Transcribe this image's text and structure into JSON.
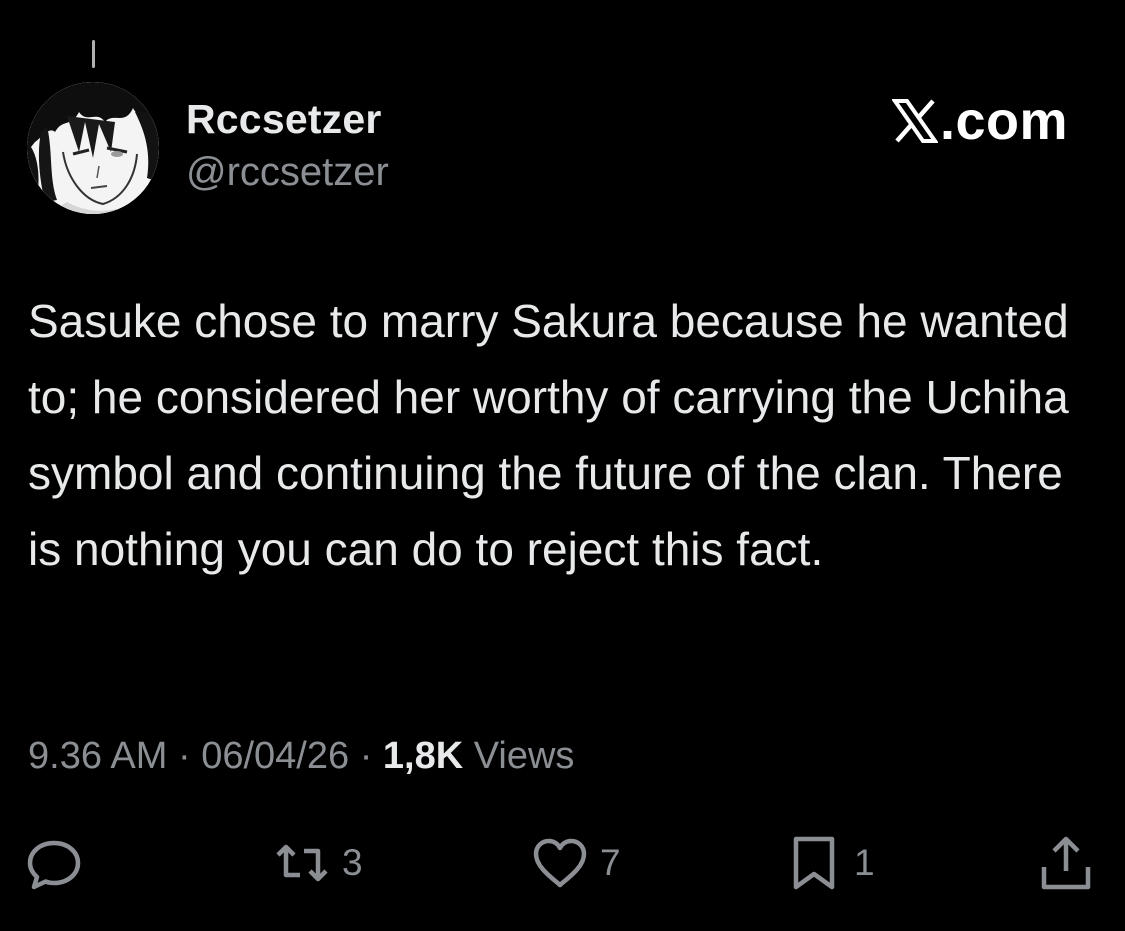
{
  "author": {
    "display_name": "Rccsetzer",
    "handle": "@rccsetzer"
  },
  "brand": {
    "text": ".com",
    "logo_icon": "x-logo-icon"
  },
  "tweet": {
    "text": "Sasuke chose to marry Sakura because he wanted to; he considered her worthy of carrying the Uchiha symbol and continuing the future of the clan. There is nothing you can do to reject this fact."
  },
  "meta": {
    "time": "9.36 AM",
    "separator": "·",
    "date": "06/04/26",
    "views_count": "1,8K",
    "views_label": "Views"
  },
  "actions": {
    "reply": {
      "icon": "reply-icon",
      "count": ""
    },
    "repost": {
      "icon": "repost-icon",
      "count": "3"
    },
    "like": {
      "icon": "heart-icon",
      "count": "7"
    },
    "bookmark": {
      "icon": "bookmark-icon",
      "count": "1"
    },
    "share": {
      "icon": "share-icon",
      "count": ""
    }
  },
  "colors": {
    "background": "#000000",
    "primary_text": "#e7e9ea",
    "secondary_text": "#8b8f94"
  }
}
